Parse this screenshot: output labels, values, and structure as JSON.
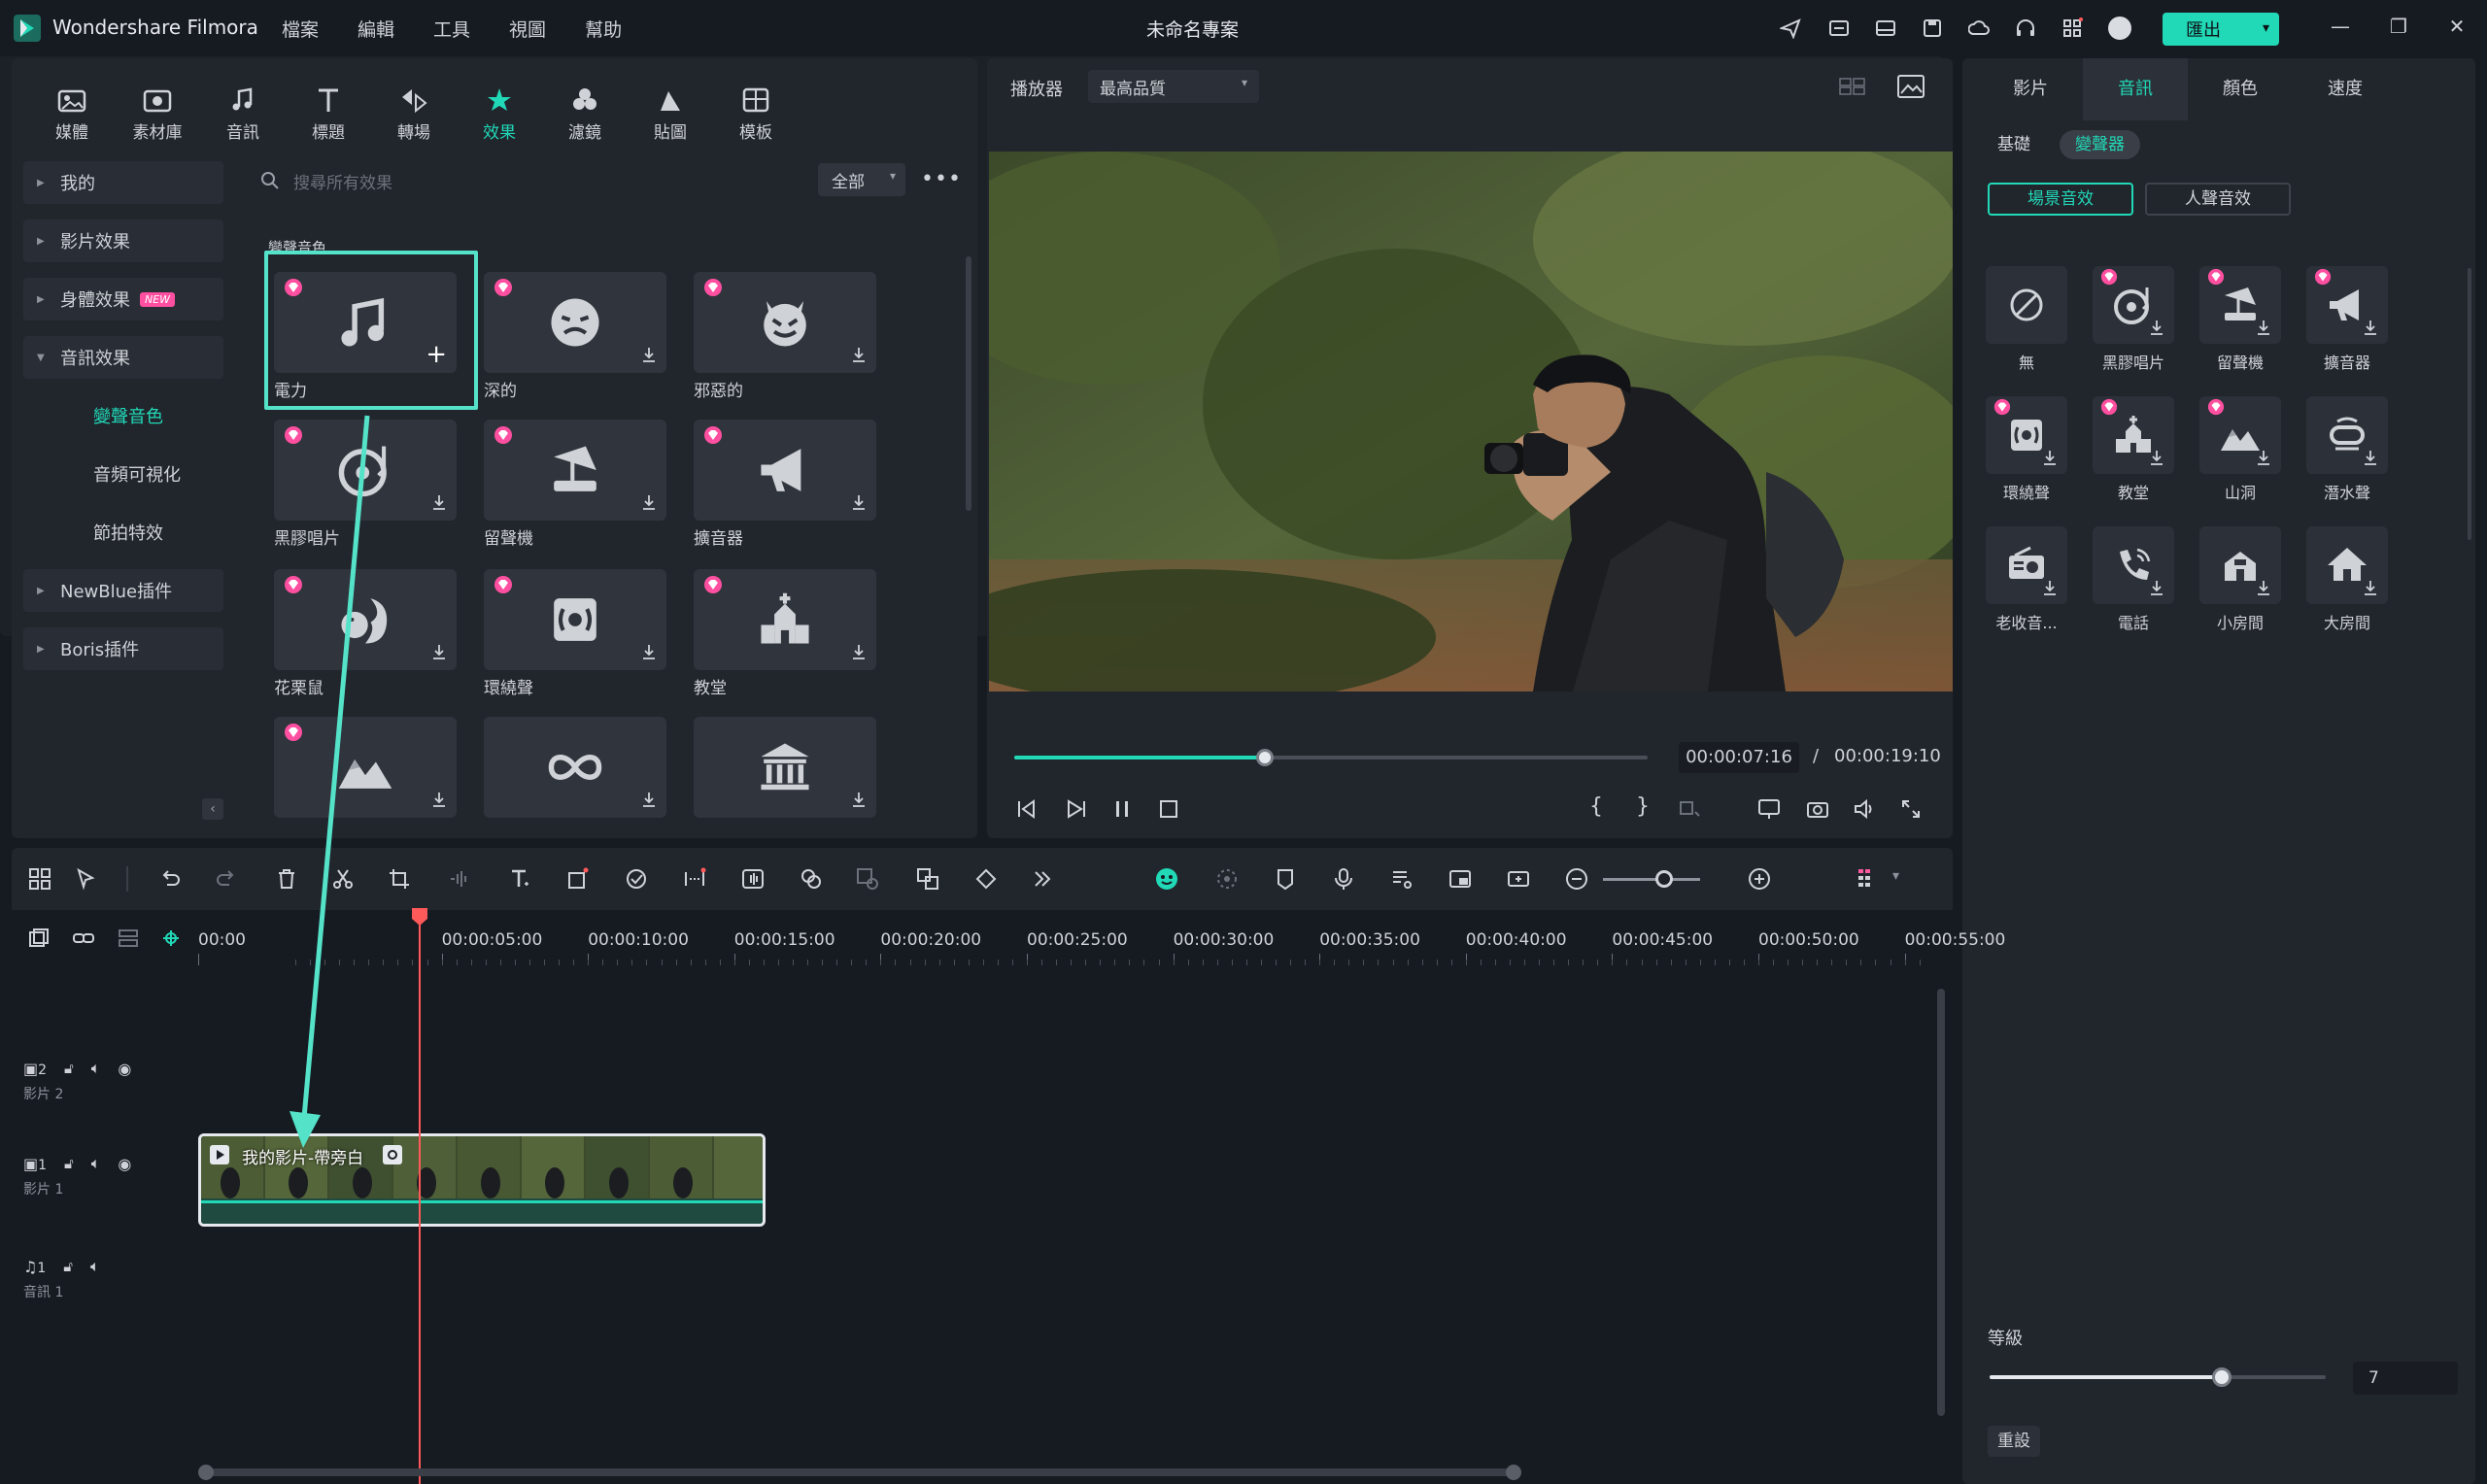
{
  "app": {
    "name": "Wondershare Filmora",
    "project_title": "未命名專案",
    "export_label": "匯出"
  },
  "menu": [
    "檔案",
    "編輯",
    "工具",
    "視圖",
    "幫助"
  ],
  "top_tabs": [
    {
      "label": "媒體",
      "icon": "media-icon"
    },
    {
      "label": "素材庫",
      "icon": "stock-icon"
    },
    {
      "label": "音訊",
      "icon": "music-icon"
    },
    {
      "label": "標題",
      "icon": "title-icon"
    },
    {
      "label": "轉場",
      "icon": "transition-icon"
    },
    {
      "label": "效果",
      "icon": "effects-icon",
      "active": true
    },
    {
      "label": "濾鏡",
      "icon": "filter-icon"
    },
    {
      "label": "貼圖",
      "icon": "sticker-icon"
    },
    {
      "label": "模板",
      "icon": "template-icon"
    }
  ],
  "categories": [
    {
      "label": "我的",
      "type": "group"
    },
    {
      "label": "影片效果",
      "type": "group"
    },
    {
      "label": "身體效果",
      "type": "group",
      "badge": "NEW"
    },
    {
      "label": "音訊效果",
      "type": "group",
      "expanded": true
    },
    {
      "label": "變聲音色",
      "type": "sub",
      "active": true
    },
    {
      "label": "音頻可視化",
      "type": "sub"
    },
    {
      "label": "節拍特效",
      "type": "sub"
    },
    {
      "label": "NewBlue插件",
      "type": "group"
    },
    {
      "label": "Boris插件",
      "type": "group"
    }
  ],
  "search": {
    "placeholder": "搜尋所有效果",
    "filter_value": "全部"
  },
  "section_label": "變聲音色",
  "effects": [
    {
      "name": "電力",
      "icon": "music-note-icon",
      "premium": true,
      "selected": true
    },
    {
      "name": "深的",
      "icon": "deep-face-icon",
      "premium": true
    },
    {
      "name": "邪惡的",
      "icon": "devil-icon",
      "premium": true
    },
    {
      "name": "黑膠唱片",
      "icon": "vinyl-icon",
      "premium": true
    },
    {
      "name": "留聲機",
      "icon": "gramophone-icon",
      "premium": true
    },
    {
      "name": "擴音器",
      "icon": "megaphone-icon",
      "premium": true
    },
    {
      "name": "花栗鼠",
      "icon": "chipmunk-icon",
      "premium": true
    },
    {
      "name": "環繞聲",
      "icon": "surround-icon",
      "premium": true
    },
    {
      "name": "教堂",
      "icon": "church-icon",
      "premium": true
    },
    {
      "name": "",
      "icon": "mountain-icon",
      "premium": true
    },
    {
      "name": "",
      "icon": "infinity-icon",
      "premium": false
    },
    {
      "name": "",
      "icon": "hall-icon",
      "premium": false
    }
  ],
  "player": {
    "label": "播放器",
    "quality": "最高品質",
    "time_current": "00:00:07:16",
    "time_separator": "/",
    "time_total": "00:00:19:10",
    "progress": 0.395
  },
  "props": {
    "tabs": [
      {
        "label": "影片"
      },
      {
        "label": "音訊",
        "active": true
      },
      {
        "label": "顏色"
      },
      {
        "label": "速度"
      }
    ],
    "sub_tabs": [
      {
        "label": "基礎"
      },
      {
        "label": "變聲器",
        "active": true
      }
    ],
    "seg_tabs": [
      {
        "label": "場景音效",
        "active": true
      },
      {
        "label": "人聲音效"
      }
    ],
    "presets": [
      {
        "name": "無",
        "icon": "none-icon",
        "premium": false
      },
      {
        "name": "黑膠唱片",
        "icon": "vinyl-icon",
        "premium": true
      },
      {
        "name": "留聲機",
        "icon": "gramophone-icon",
        "premium": true
      },
      {
        "name": "擴音器",
        "icon": "megaphone-icon",
        "premium": true
      },
      {
        "name": "環繞聲",
        "icon": "surround-icon",
        "premium": true
      },
      {
        "name": "教堂",
        "icon": "church-icon",
        "premium": true
      },
      {
        "name": "山洞",
        "icon": "mountain-icon",
        "premium": true
      },
      {
        "name": "潛水聲",
        "icon": "diving-icon",
        "premium": false
      },
      {
        "name": "老收音...",
        "icon": "radio-icon",
        "premium": false
      },
      {
        "name": "電話",
        "icon": "phone-icon",
        "premium": false
      },
      {
        "name": "小房間",
        "icon": "small-room-icon",
        "premium": false
      },
      {
        "name": "大房間",
        "icon": "big-room-icon",
        "premium": false
      }
    ],
    "level_label": "等級",
    "level_value": "7",
    "level_fraction": 0.69,
    "reset_label": "重設"
  },
  "timeline": {
    "ticks": [
      "00:00",
      "00:00:05:00",
      "00:00:10:00",
      "00:00:15:00",
      "00:00:20:00",
      "00:00:25:00",
      "00:00:30:00",
      "00:00:35:00",
      "00:00:40:00",
      "00:00:45:00",
      "00:00:50:00",
      "00:00:55:00"
    ],
    "tracks": [
      {
        "number": "2",
        "name": "影片 2",
        "kind": "video"
      },
      {
        "number": "1",
        "name": "影片 1",
        "kind": "video"
      },
      {
        "number": "1",
        "name": "音訊 1",
        "kind": "audio"
      }
    ],
    "clip_title": "我的影片-帶旁白"
  },
  "colors": {
    "accent": "#21d8b7",
    "premium_gem": "#ff4fa0",
    "playhead": "#ff5a5a"
  }
}
